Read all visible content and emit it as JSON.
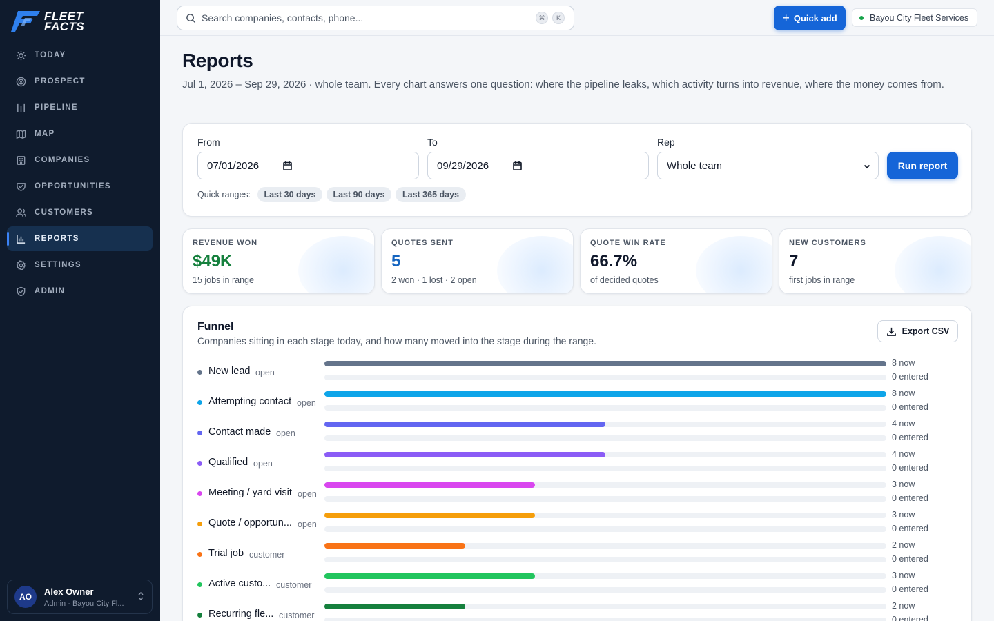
{
  "brand": {
    "line1": "FLEET",
    "line2": "FACTS"
  },
  "sidebar": {
    "items": [
      {
        "label": "TODAY",
        "icon": "sun-icon"
      },
      {
        "label": "PROSPECT",
        "icon": "target-icon"
      },
      {
        "label": "PIPELINE",
        "icon": "pipeline-icon"
      },
      {
        "label": "MAP",
        "icon": "map-icon"
      },
      {
        "label": "COMPANIES",
        "icon": "building-icon"
      },
      {
        "label": "OPPORTUNITIES",
        "icon": "handshake-icon"
      },
      {
        "label": "CUSTOMERS",
        "icon": "users-icon"
      },
      {
        "label": "REPORTS",
        "icon": "bar-chart-icon",
        "active": true
      },
      {
        "label": "SETTINGS",
        "icon": "gear-icon"
      },
      {
        "label": "ADMIN",
        "icon": "shield-icon"
      }
    ],
    "user": {
      "initials": "AO",
      "name": "Alex Owner",
      "role": "Admin · Bayou City Fl..."
    }
  },
  "topbar": {
    "search_placeholder": "Search companies, contacts, phone...",
    "shortcut_keys": [
      "⌘",
      "K"
    ],
    "quick_add_label": "Quick add",
    "org_name": "Bayou City Fleet Services",
    "org_status_color": "#16a34a"
  },
  "page": {
    "title": "Reports",
    "subtitle": "Jul 1, 2026 – Sep 29, 2026 · whole team. Every chart answers one question: where the pipeline leaks, which activity turns into revenue, where the money comes from."
  },
  "filters": {
    "from_label": "From",
    "from_value": "07/01/2026",
    "to_label": "To",
    "to_value": "09/29/2026",
    "rep_label": "Rep",
    "rep_value": "Whole team",
    "run_label": "Run report",
    "quick_ranges_label": "Quick ranges:",
    "quick_ranges": [
      "Last 30 days",
      "Last 90 days",
      "Last 365 days"
    ]
  },
  "kpis": [
    {
      "label": "REVENUE WON",
      "value": "$49K",
      "note": "15 jobs in range",
      "color": "#15803d"
    },
    {
      "label": "QUOTES SENT",
      "value": "5",
      "note": "2 won · 1 lost · 2 open",
      "color": "#1565c0"
    },
    {
      "label": "QUOTE WIN RATE",
      "value": "66.7%",
      "note": "of decided quotes",
      "color": "#0f172a"
    },
    {
      "label": "NEW CUSTOMERS",
      "value": "7",
      "note": "first jobs in range",
      "color": "#0f172a"
    }
  ],
  "funnel": {
    "title": "Funnel",
    "subtitle": "Companies sitting in each stage today, and how many moved into the stage during the range.",
    "export_label": "Export CSV",
    "max_now": 8,
    "stages": [
      {
        "name": "New lead",
        "kind": "open",
        "now": 8,
        "entered": 0,
        "now_text": "8 now",
        "entered_text": "0 entered",
        "color": "#64748b"
      },
      {
        "name": "Attempting contact",
        "kind": "open",
        "now": 8,
        "entered": 0,
        "now_text": "8 now",
        "entered_text": "0 entered",
        "color": "#0ea5e9"
      },
      {
        "name": "Contact made",
        "kind": "open",
        "now": 4,
        "entered": 0,
        "now_text": "4 now",
        "entered_text": "0 entered",
        "color": "#6366f1"
      },
      {
        "name": "Qualified",
        "kind": "open",
        "now": 4,
        "entered": 0,
        "now_text": "4 now",
        "entered_text": "0 entered",
        "color": "#8b5cf6"
      },
      {
        "name": "Meeting / yard visit",
        "kind": "open",
        "now": 3,
        "entered": 0,
        "now_text": "3 now",
        "entered_text": "0 entered",
        "color": "#d946ef"
      },
      {
        "name": "Quote / opportun...",
        "kind": "open",
        "now": 3,
        "entered": 0,
        "now_text": "3 now",
        "entered_text": "0 entered",
        "color": "#f59e0b"
      },
      {
        "name": "Trial job",
        "kind": "customer",
        "now": 2,
        "entered": 0,
        "now_text": "2 now",
        "entered_text": "0 entered",
        "color": "#f97316"
      },
      {
        "name": "Active custo...",
        "kind": "customer",
        "now": 3,
        "entered": 0,
        "now_text": "3 now",
        "entered_text": "0 entered",
        "color": "#22c55e"
      },
      {
        "name": "Recurring fle...",
        "kind": "customer",
        "now": 2,
        "entered": 0,
        "now_text": "2 now",
        "entered_text": "0 entered",
        "color": "#15803d"
      }
    ]
  }
}
